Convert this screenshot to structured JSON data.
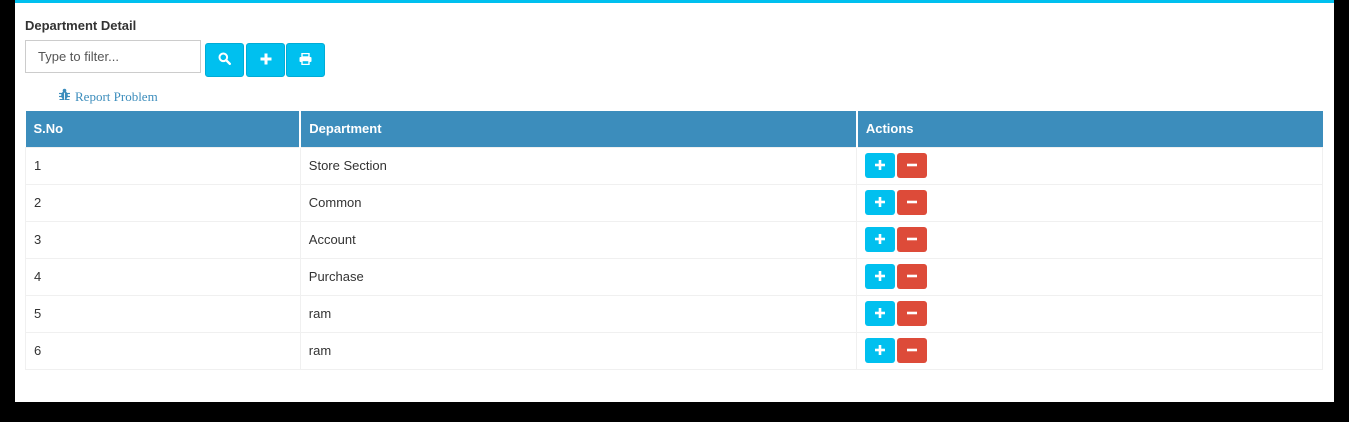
{
  "panel": {
    "title": "Department Detail"
  },
  "filter": {
    "placeholder": "Type to filter..."
  },
  "toolbar": {
    "search_icon": "search-icon",
    "add_icon": "plus-icon",
    "print_icon": "print-icon"
  },
  "report": {
    "label": "Report Problem",
    "icon": "bug-icon"
  },
  "table": {
    "headers": {
      "sno": "S.No",
      "department": "Department",
      "actions": "Actions"
    },
    "rows": [
      {
        "sno": "1",
        "department": "Store Section"
      },
      {
        "sno": "2",
        "department": "Common"
      },
      {
        "sno": "3",
        "department": "Account"
      },
      {
        "sno": "4",
        "department": "Purchase"
      },
      {
        "sno": "5",
        "department": "ram"
      },
      {
        "sno": "6",
        "department": "ram"
      }
    ]
  },
  "colors": {
    "accent": "#00c0ef",
    "header": "#3c8dbc",
    "danger": "#dd4b39"
  }
}
